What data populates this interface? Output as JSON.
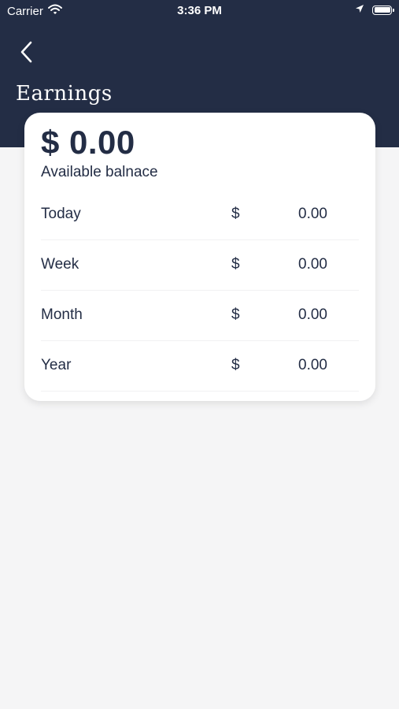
{
  "status_bar": {
    "carrier": "Carrier",
    "time": "3:36 PM"
  },
  "header": {
    "title": "Earnings",
    "background": "#232d45"
  },
  "balance": {
    "amount": "$ 0.00",
    "label": "Available balnace"
  },
  "rows": [
    {
      "label": "Today",
      "currency": "$",
      "value": "0.00"
    },
    {
      "label": "Week",
      "currency": "$",
      "value": "0.00"
    },
    {
      "label": "Month",
      "currency": "$",
      "value": "0.00"
    },
    {
      "label": "Year",
      "currency": "$",
      "value": "0.00"
    }
  ]
}
